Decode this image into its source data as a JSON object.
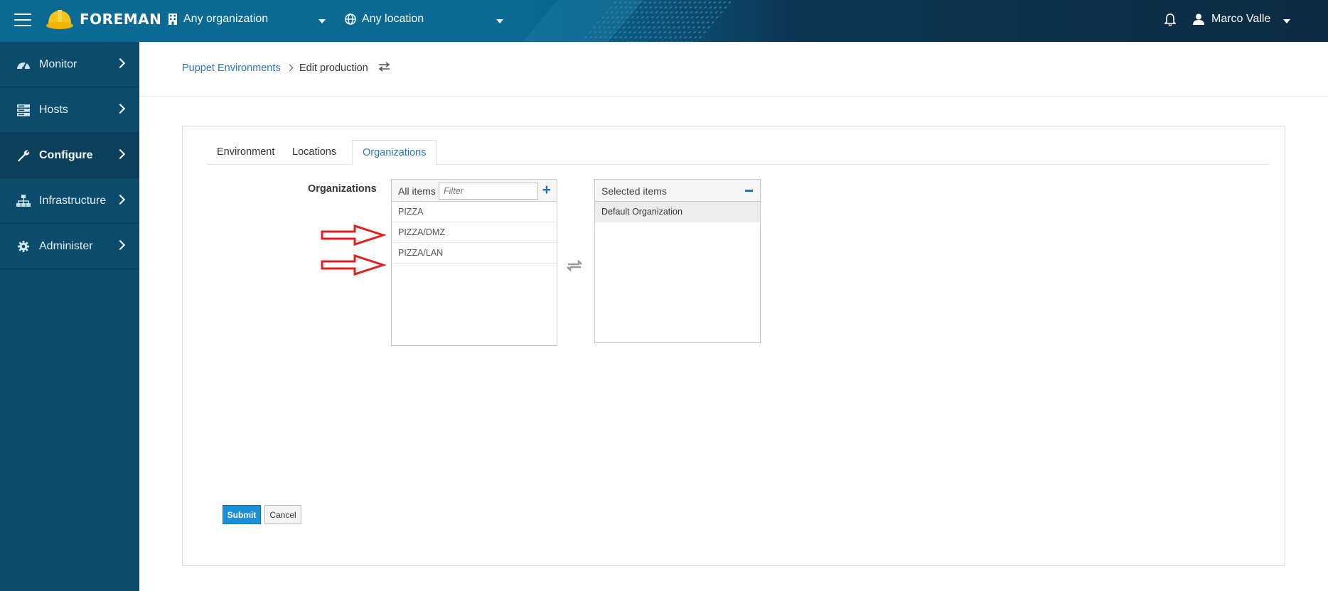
{
  "header": {
    "brand": "FOREMAN",
    "organization": "Any organization",
    "location": "Any location",
    "user": "Marco Valle"
  },
  "sidebar": {
    "items": [
      {
        "label": "Monitor",
        "icon": "dashboard-icon"
      },
      {
        "label": "Hosts",
        "icon": "server-icon"
      },
      {
        "label": "Configure",
        "icon": "wrench-icon",
        "active": true
      },
      {
        "label": "Infrastructure",
        "icon": "sitemap-icon"
      },
      {
        "label": "Administer",
        "icon": "gear-icon"
      }
    ]
  },
  "breadcrumb": {
    "parent": "Puppet Environments",
    "current": "Edit production"
  },
  "tabs": [
    {
      "label": "Environment"
    },
    {
      "label": "Locations"
    },
    {
      "label": "Organizations",
      "active": true
    }
  ],
  "form": {
    "field_label": "Organizations",
    "all_items": {
      "title": "All items",
      "filter_placeholder": "Filter",
      "items": [
        "PIZZA",
        "PIZZA/DMZ",
        "PIZZA/LAN"
      ]
    },
    "selected_items": {
      "title": "Selected items",
      "items": [
        "Default Organization"
      ]
    },
    "submit_label": "Submit",
    "cancel_label": "Cancel"
  },
  "colors": {
    "topbar": "#0a6a93",
    "sidebar": "#0b4b6b",
    "link": "#2d75b7",
    "primary_button": "#1b8fd8",
    "annotation_arrow": "#e02020"
  }
}
